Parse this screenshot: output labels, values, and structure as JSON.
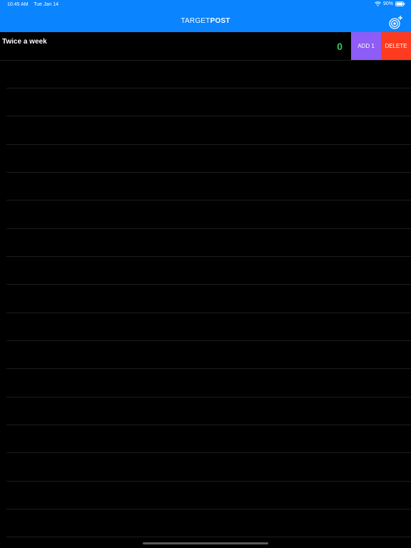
{
  "status": {
    "time": "10:45 AM",
    "date": "Tue Jan 14",
    "battery": "90%"
  },
  "nav": {
    "title_light": "TARGET",
    "title_bold": "POST",
    "add_icon": "target-plus-icon"
  },
  "rows": [
    {
      "title": "Twice a week",
      "count": "0",
      "add_label": "ADD 1",
      "delete_label": "DELETE"
    }
  ],
  "colors": {
    "header": "#0a84ff",
    "count": "#34c759",
    "add": "#8e5cf7",
    "delete": "#ff3b1f"
  }
}
